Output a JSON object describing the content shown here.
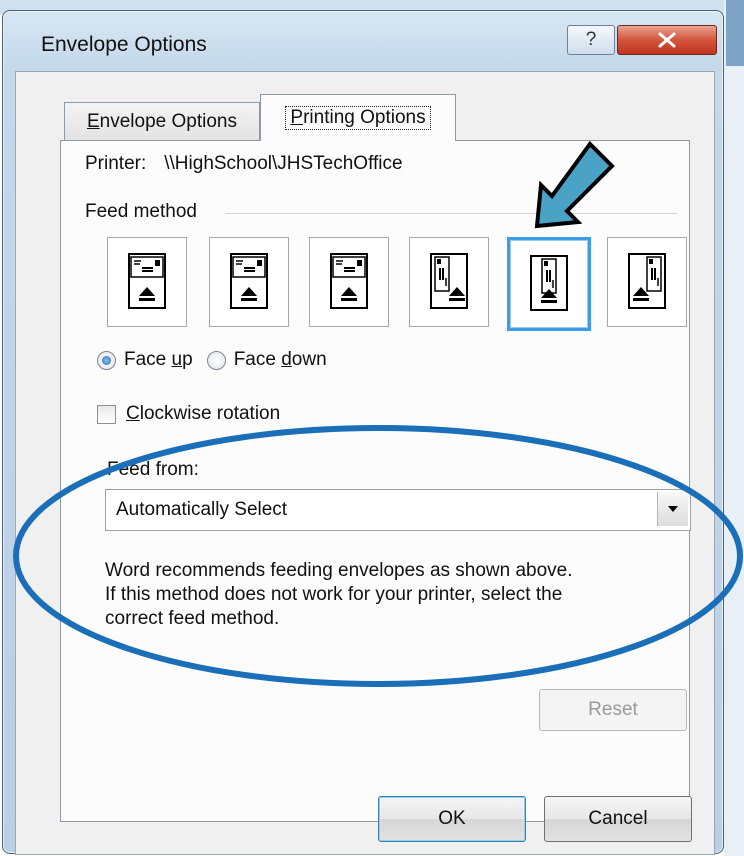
{
  "window": {
    "title": "Envelope Options",
    "help_glyph": "?"
  },
  "tabs": [
    {
      "label": "Envelope Options",
      "accesskey": "E"
    },
    {
      "label": "Printing Options",
      "accesskey": "P"
    }
  ],
  "printer": {
    "label": "Printer:",
    "value": "\\\\HighSchool\\JHSTechOffice"
  },
  "feed_method": {
    "label": "Feed method",
    "options": [
      {
        "orientation": "landscape",
        "position": "left",
        "selected": false
      },
      {
        "orientation": "landscape",
        "position": "center",
        "selected": false
      },
      {
        "orientation": "landscape",
        "position": "right",
        "selected": false
      },
      {
        "orientation": "portrait",
        "position": "left",
        "selected": false
      },
      {
        "orientation": "portrait",
        "position": "center",
        "selected": true
      },
      {
        "orientation": "portrait",
        "position": "right",
        "selected": false
      }
    ]
  },
  "face": {
    "up_label": "Face up",
    "down_label": "Face down",
    "selected": "up"
  },
  "rotation": {
    "label": "Clockwise rotation",
    "checked": false
  },
  "feed_from": {
    "label": "Feed from:",
    "value": "Automatically Select"
  },
  "note": {
    "lines": [
      "Word recommends feeding envelopes as shown above.",
      "If this method does not work for your printer, select the",
      "correct feed method."
    ]
  },
  "buttons": {
    "reset": "Reset",
    "ok": "OK",
    "cancel": "Cancel"
  },
  "colors": {
    "selection_border": "#3d9be9",
    "annotation_arrow": "#4aa3c6",
    "annotation_ellipse": "#1a6fb8",
    "close_button": "#c94229"
  },
  "icons": {
    "help": "help-icon",
    "close": "close-icon",
    "feed_eject": "eject-arrow-icon",
    "dropdown": "chevron-down-icon"
  }
}
